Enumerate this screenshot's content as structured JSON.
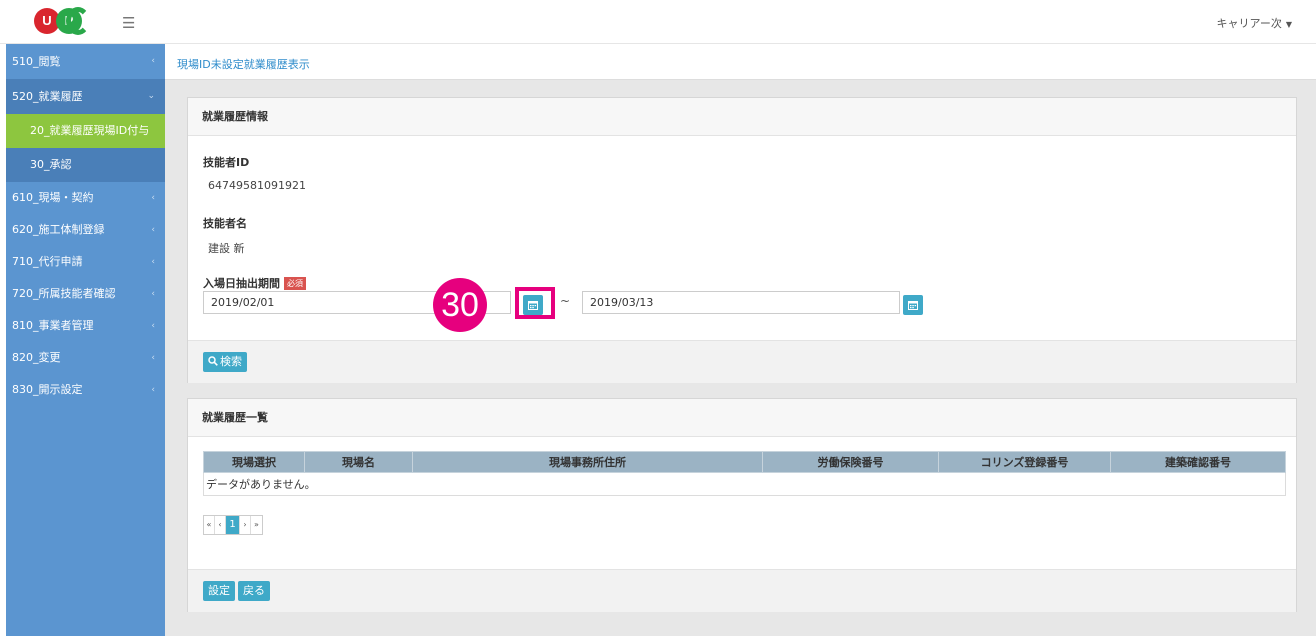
{
  "header": {
    "logo_left": "U",
    "logo_right": "P",
    "user_menu": "キャリアー次"
  },
  "sidebar": {
    "items": [
      {
        "label": "510_閲覧"
      },
      {
        "label": "520_就業履歴"
      },
      {
        "label": "20_就業履歴現場ID付与"
      },
      {
        "label": "30_承認"
      },
      {
        "label": "610_現場・契約"
      },
      {
        "label": "620_施工体制登録"
      },
      {
        "label": "710_代行申請"
      },
      {
        "label": "720_所属技能者確認"
      },
      {
        "label": "810_事業者管理"
      },
      {
        "label": "820_変更"
      },
      {
        "label": "830_開示設定"
      }
    ]
  },
  "breadcrumb": "現場ID未設定就業履歴表示",
  "info_panel": {
    "title": "就業履歴情報",
    "worker_id_label": "技能者ID",
    "worker_id_value": "64749581091921",
    "worker_name_label": "技能者名",
    "worker_name_value": "建設 新",
    "period_label": "入場日抽出期間",
    "required_badge": "必須",
    "date_from": "2019/02/01",
    "tilde": "~",
    "date_to": "2019/03/13",
    "search_button": "検索"
  },
  "annotation": {
    "step_number": "30",
    "color": "#e6007e"
  },
  "list_panel": {
    "title": "就業履歴一覧",
    "columns": [
      "現場選択",
      "現場名",
      "現場事務所住所",
      "労働保険番号",
      "コリンズ登録番号",
      "建築確認番号"
    ],
    "empty_message": "データがありません。",
    "pager": [
      "«",
      "‹",
      "1",
      "›",
      "»"
    ],
    "set_button": "設定",
    "back_button": "戻る"
  },
  "colors": {
    "sidebar": "#5b95d0",
    "sidebar_active": "#8dc63f",
    "accent": "#3fa9c8",
    "link": "#2f8ccb"
  }
}
